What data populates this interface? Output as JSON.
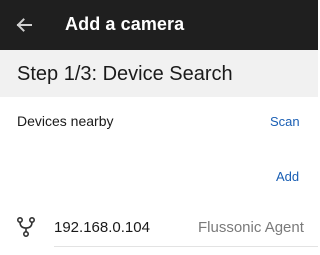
{
  "appbar": {
    "title": "Add a camera",
    "back_icon": "arrow-left-icon"
  },
  "step": {
    "title": "Step 1/3: Device Search"
  },
  "devices_section": {
    "label": "Devices nearby",
    "scan_label": "Scan",
    "add_label": "Add"
  },
  "devices": [
    {
      "ip": "192.168.0.104",
      "type": "Flussonic Agent",
      "icon": "network-icon"
    }
  ],
  "colors": {
    "appbar_bg": "#1f1f1f",
    "header_bg": "#f1f1f1",
    "accent": "#1a5fb4"
  }
}
